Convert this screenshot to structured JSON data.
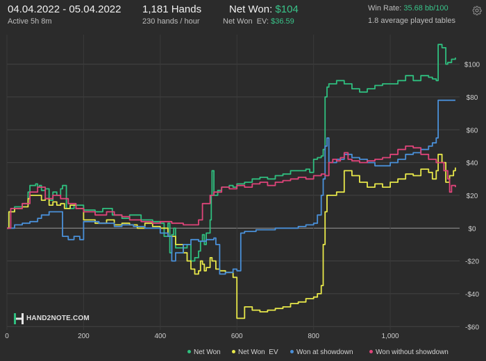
{
  "header": {
    "date_range": "04.04.2022 - 05.04.2022",
    "active": "Active 5h 8m",
    "hands": "1,181 Hands",
    "hands_per_hour": "230 hands / hour",
    "net_won_label": "Net Won: ",
    "net_won_value": "$104",
    "net_won_ev_label": "Net Won  EV: ",
    "net_won_ev_value": "$36.59",
    "win_rate_label": "Win Rate: ",
    "win_rate_value": "35.68 bb/100",
    "tables": "1.8 average played tables"
  },
  "logo": {
    "text": "HAND2NOTE.COM"
  },
  "icons": {
    "settings": "gear-icon"
  },
  "chart_data": {
    "type": "line",
    "x_ticks": [
      "0",
      "200",
      "400",
      "600",
      "800",
      "1,000"
    ],
    "y_ticks": [
      "$100",
      "$80",
      "$60",
      "$40",
      "$20",
      "$0",
      "-$20",
      "-$40",
      "-$60"
    ],
    "xlim": [
      0,
      1181
    ],
    "ylim": [
      -62,
      118
    ],
    "colors": {
      "net_won": "#2fbf7f",
      "net_won_ev": "#e8e84a",
      "showdown": "#4a90d9",
      "non_showdown": "#e0447a"
    },
    "series": [
      {
        "name": "Net Won",
        "color": "#2fbf7f",
        "points": [
          [
            0,
            0
          ],
          [
            5,
            10
          ],
          [
            20,
            13
          ],
          [
            40,
            15
          ],
          [
            55,
            22
          ],
          [
            60,
            26
          ],
          [
            75,
            27
          ],
          [
            80,
            25
          ],
          [
            85,
            26
          ],
          [
            90,
            23
          ],
          [
            100,
            24
          ],
          [
            110,
            17
          ],
          [
            120,
            22
          ],
          [
            130,
            20
          ],
          [
            140,
            24
          ],
          [
            145,
            26
          ],
          [
            150,
            26
          ],
          [
            155,
            12
          ],
          [
            175,
            14
          ],
          [
            200,
            11
          ],
          [
            230,
            10
          ],
          [
            250,
            12
          ],
          [
            275,
            8
          ],
          [
            300,
            6
          ],
          [
            320,
            8
          ],
          [
            350,
            5
          ],
          [
            380,
            4
          ],
          [
            400,
            3
          ],
          [
            410,
            -5
          ],
          [
            420,
            3
          ],
          [
            425,
            -15
          ],
          [
            430,
            -4
          ],
          [
            435,
            0
          ],
          [
            440,
            -12
          ],
          [
            470,
            -10
          ],
          [
            480,
            -20
          ],
          [
            490,
            -18
          ],
          [
            500,
            -14
          ],
          [
            505,
            -8
          ],
          [
            510,
            -4
          ],
          [
            515,
            -10
          ],
          [
            520,
            -3
          ],
          [
            530,
            5
          ],
          [
            533,
            20
          ],
          [
            535,
            35
          ],
          [
            540,
            20
          ],
          [
            545,
            20
          ],
          [
            550,
            23
          ],
          [
            560,
            25
          ],
          [
            570,
            25
          ],
          [
            580,
            26
          ],
          [
            590,
            25
          ],
          [
            600,
            27
          ],
          [
            610,
            27
          ],
          [
            620,
            28
          ],
          [
            640,
            30
          ],
          [
            660,
            31
          ],
          [
            680,
            30
          ],
          [
            700,
            32
          ],
          [
            720,
            33
          ],
          [
            740,
            35
          ],
          [
            760,
            35
          ],
          [
            780,
            36
          ],
          [
            790,
            34
          ],
          [
            800,
            42
          ],
          [
            810,
            43
          ],
          [
            820,
            44
          ],
          [
            825,
            48
          ],
          [
            830,
            80
          ],
          [
            835,
            86
          ],
          [
            840,
            88
          ],
          [
            860,
            90
          ],
          [
            880,
            88
          ],
          [
            900,
            85
          ],
          [
            920,
            83
          ],
          [
            940,
            85
          ],
          [
            960,
            87
          ],
          [
            980,
            88
          ],
          [
            1000,
            88
          ],
          [
            1020,
            90
          ],
          [
            1040,
            93
          ],
          [
            1060,
            90
          ],
          [
            1080,
            93
          ],
          [
            1100,
            92
          ],
          [
            1110,
            91
          ],
          [
            1120,
            90
          ],
          [
            1125,
            112
          ],
          [
            1135,
            110
          ],
          [
            1145,
            100
          ],
          [
            1150,
            101
          ],
          [
            1160,
            103
          ],
          [
            1170,
            104
          ]
        ]
      },
      {
        "name": "Net Won  EV",
        "color": "#e8e84a",
        "points": [
          [
            0,
            0
          ],
          [
            5,
            10
          ],
          [
            20,
            12
          ],
          [
            40,
            13
          ],
          [
            55,
            18
          ],
          [
            60,
            20
          ],
          [
            75,
            20
          ],
          [
            90,
            17
          ],
          [
            100,
            18
          ],
          [
            110,
            14
          ],
          [
            120,
            16
          ],
          [
            130,
            14
          ],
          [
            140,
            15
          ],
          [
            150,
            12
          ],
          [
            165,
            14
          ],
          [
            180,
            12
          ],
          [
            200,
            5
          ],
          [
            230,
            3
          ],
          [
            260,
            5
          ],
          [
            280,
            2
          ],
          [
            300,
            3
          ],
          [
            320,
            2
          ],
          [
            340,
            0
          ],
          [
            360,
            3
          ],
          [
            380,
            1
          ],
          [
            400,
            0
          ],
          [
            420,
            -5
          ],
          [
            440,
            -10
          ],
          [
            460,
            -15
          ],
          [
            470,
            -20
          ],
          [
            480,
            -25
          ],
          [
            490,
            -28
          ],
          [
            500,
            -26
          ],
          [
            505,
            -20
          ],
          [
            510,
            -22
          ],
          [
            515,
            -26
          ],
          [
            520,
            -24
          ],
          [
            530,
            -18
          ],
          [
            535,
            -20
          ],
          [
            545,
            -25
          ],
          [
            555,
            -26
          ],
          [
            570,
            -27
          ],
          [
            580,
            -27
          ],
          [
            590,
            -30
          ],
          [
            600,
            -55
          ],
          [
            620,
            -48
          ],
          [
            640,
            -50
          ],
          [
            660,
            -51
          ],
          [
            680,
            -50
          ],
          [
            700,
            -49
          ],
          [
            720,
            -48
          ],
          [
            740,
            -46
          ],
          [
            760,
            -45
          ],
          [
            780,
            -43
          ],
          [
            800,
            -42
          ],
          [
            810,
            -40
          ],
          [
            820,
            -35
          ],
          [
            825,
            -10
          ],
          [
            830,
            10
          ],
          [
            835,
            20
          ],
          [
            840,
            20
          ],
          [
            860,
            22
          ],
          [
            880,
            35
          ],
          [
            900,
            32
          ],
          [
            920,
            28
          ],
          [
            940,
            25
          ],
          [
            960,
            27
          ],
          [
            980,
            25
          ],
          [
            1000,
            28
          ],
          [
            1020,
            30
          ],
          [
            1040,
            33
          ],
          [
            1060,
            32
          ],
          [
            1080,
            36
          ],
          [
            1100,
            34
          ],
          [
            1110,
            30
          ],
          [
            1120,
            35
          ],
          [
            1125,
            45
          ],
          [
            1135,
            40
          ],
          [
            1145,
            28
          ],
          [
            1155,
            32
          ],
          [
            1165,
            35
          ],
          [
            1170,
            37
          ]
        ]
      },
      {
        "name": "Won at showdown",
        "color": "#4a90d9",
        "points": [
          [
            0,
            0
          ],
          [
            20,
            2
          ],
          [
            40,
            3
          ],
          [
            60,
            4
          ],
          [
            80,
            6
          ],
          [
            90,
            8
          ],
          [
            110,
            10
          ],
          [
            140,
            10
          ],
          [
            145,
            -5
          ],
          [
            160,
            -7
          ],
          [
            175,
            -5
          ],
          [
            190,
            -7
          ],
          [
            200,
            4
          ],
          [
            240,
            3
          ],
          [
            260,
            3
          ],
          [
            280,
            1
          ],
          [
            300,
            2
          ],
          [
            330,
            1
          ],
          [
            360,
            0
          ],
          [
            400,
            -3
          ],
          [
            420,
            -5
          ],
          [
            430,
            -20
          ],
          [
            440,
            -15
          ],
          [
            460,
            -10
          ],
          [
            480,
            -7
          ],
          [
            500,
            -8
          ],
          [
            520,
            -7
          ],
          [
            540,
            -6
          ],
          [
            545,
            -10
          ],
          [
            555,
            -28
          ],
          [
            570,
            -27
          ],
          [
            590,
            -25
          ],
          [
            600,
            -26
          ],
          [
            610,
            -3
          ],
          [
            620,
            -2
          ],
          [
            650,
            -1
          ],
          [
            700,
            0
          ],
          [
            740,
            0
          ],
          [
            760,
            1
          ],
          [
            780,
            2
          ],
          [
            800,
            3
          ],
          [
            810,
            8
          ],
          [
            820,
            20
          ],
          [
            825,
            30
          ],
          [
            830,
            50
          ],
          [
            835,
            55
          ],
          [
            840,
            40
          ],
          [
            860,
            42
          ],
          [
            880,
            45
          ],
          [
            900,
            43
          ],
          [
            920,
            42
          ],
          [
            940,
            40
          ],
          [
            960,
            38
          ],
          [
            980,
            38
          ],
          [
            1000,
            40
          ],
          [
            1020,
            42
          ],
          [
            1040,
            45
          ],
          [
            1060,
            46
          ],
          [
            1080,
            48
          ],
          [
            1100,
            50
          ],
          [
            1110,
            52
          ],
          [
            1120,
            55
          ],
          [
            1125,
            78
          ],
          [
            1150,
            78
          ],
          [
            1170,
            78
          ]
        ]
      },
      {
        "name": "Won without showdown",
        "color": "#e0447a",
        "points": [
          [
            0,
            0
          ],
          [
            10,
            12
          ],
          [
            40,
            15
          ],
          [
            60,
            22
          ],
          [
            80,
            25
          ],
          [
            100,
            18
          ],
          [
            120,
            20
          ],
          [
            140,
            18
          ],
          [
            160,
            15
          ],
          [
            180,
            12
          ],
          [
            200,
            10
          ],
          [
            230,
            8
          ],
          [
            260,
            10
          ],
          [
            280,
            8
          ],
          [
            300,
            7
          ],
          [
            320,
            5
          ],
          [
            350,
            4
          ],
          [
            380,
            3
          ],
          [
            400,
            4
          ],
          [
            430,
            3
          ],
          [
            460,
            2
          ],
          [
            480,
            2
          ],
          [
            500,
            5
          ],
          [
            510,
            15
          ],
          [
            530,
            20
          ],
          [
            540,
            22
          ],
          [
            560,
            25
          ],
          [
            580,
            24
          ],
          [
            600,
            26
          ],
          [
            620,
            25
          ],
          [
            640,
            27
          ],
          [
            660,
            28
          ],
          [
            680,
            26
          ],
          [
            700,
            28
          ],
          [
            720,
            29
          ],
          [
            740,
            30
          ],
          [
            760,
            31
          ],
          [
            780,
            30
          ],
          [
            800,
            32
          ],
          [
            820,
            33
          ],
          [
            830,
            32
          ],
          [
            840,
            40
          ],
          [
            850,
            42
          ],
          [
            860,
            41
          ],
          [
            870,
            43
          ],
          [
            880,
            46
          ],
          [
            890,
            42
          ],
          [
            900,
            41
          ],
          [
            920,
            40
          ],
          [
            940,
            41
          ],
          [
            960,
            42
          ],
          [
            980,
            43
          ],
          [
            1000,
            45
          ],
          [
            1020,
            48
          ],
          [
            1040,
            50
          ],
          [
            1060,
            49
          ],
          [
            1080,
            45
          ],
          [
            1100,
            42
          ],
          [
            1120,
            40
          ],
          [
            1140,
            35
          ],
          [
            1150,
            30
          ],
          [
            1155,
            22
          ],
          [
            1160,
            26
          ],
          [
            1170,
            25
          ]
        ]
      }
    ]
  }
}
